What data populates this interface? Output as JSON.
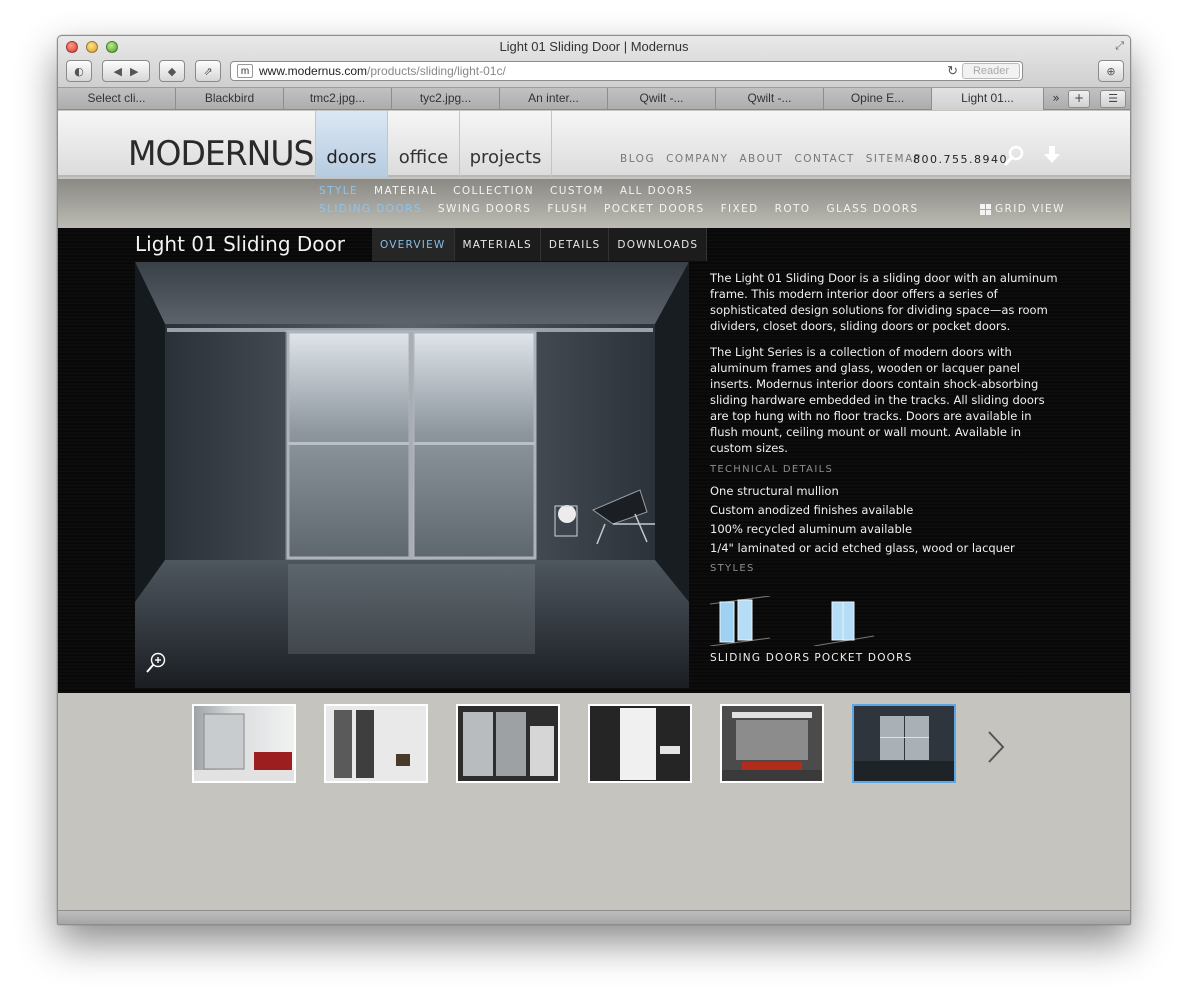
{
  "window": {
    "title": "Light 01 Sliding Door | Modernus"
  },
  "toolbar": {
    "url_prefix_icon": "m",
    "url_host": "www.modernus.com",
    "url_path": "/products/sliding/light-01c/",
    "reader_label": "Reader"
  },
  "tabs": [
    {
      "label": "Select cli..."
    },
    {
      "label": "Blackbird"
    },
    {
      "label": "tmc2.jpg..."
    },
    {
      "label": "tyc2.jpg..."
    },
    {
      "label": "An inter..."
    },
    {
      "label": "Qwilt -..."
    },
    {
      "label": "Qwilt -..."
    },
    {
      "label": "Opine E..."
    },
    {
      "label": "Light 01..."
    }
  ],
  "site": {
    "logo": "MODERNUS",
    "main_nav": [
      "doors",
      "office",
      "projects"
    ],
    "util_nav": [
      "BLOG",
      "COMPANY",
      "ABOUT",
      "CONTACT",
      "SITEMAP"
    ],
    "phone": "800.755.8940",
    "subnav_row1": [
      "STYLE",
      "MATERIAL",
      "COLLECTION",
      "CUSTOM",
      "ALL DOORS"
    ],
    "subnav_row2": [
      "SLIDING DOORS",
      "SWING DOORS",
      "FLUSH",
      "POCKET DOORS",
      "FIXED",
      "ROTO",
      "GLASS DOORS"
    ],
    "grid_view": "GRID VIEW"
  },
  "product": {
    "title": "Light 01 Sliding Door",
    "tabs": [
      "OVERVIEW",
      "MATERIALS",
      "DETAILS",
      "DOWNLOADS"
    ],
    "para1": "The Light 01 Sliding Door is a sliding door with an aluminum frame. This modern interior door offers a series of sophisticated design solutions for dividing space—as room dividers, closet doors, sliding doors or pocket doors.",
    "para2": "The Light Series is a collection of modern doors with aluminum frames and glass, wooden or lacquer panel inserts. Modernus interior doors contain shock-absorbing sliding hardware embedded in the tracks. All sliding doors are top hung with no floor tracks. Doors are available in flush mount, ceiling mount or wall mount. Available in custom sizes.",
    "tech_heading": "TECHNICAL DETAILS",
    "tech_details": [
      "One structural mullion",
      "Custom anodized finishes available",
      "100% recycled aluminum available",
      "1/4\" laminated or acid etched glass, wood or lacquer"
    ],
    "styles_heading": "STYLES",
    "styles": [
      "SLIDING DOORS",
      "POCKET DOORS"
    ]
  },
  "colors": {
    "accent_blue": "#86bfea",
    "thumb_active": "#5ba6e3"
  }
}
